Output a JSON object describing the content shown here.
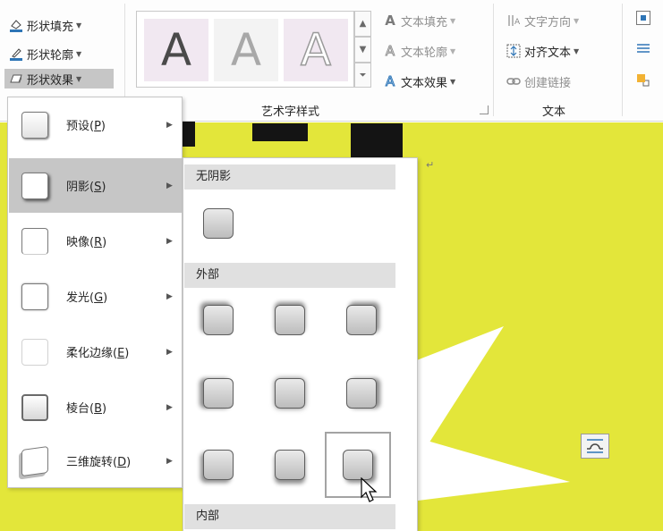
{
  "ribbon": {
    "shape_fill": "形状填充",
    "shape_outline": "形状轮廓",
    "shape_effects": "形状效果",
    "wordart_gallery": [
      "A",
      "A",
      "A"
    ],
    "text_fill": "文本填充",
    "text_outline": "文本轮廓",
    "text_effects": "文本效果",
    "wordart_group_label": "艺术字样式",
    "text_direction": "文字方向",
    "align_text": "对齐文本",
    "create_link": "创建链接",
    "text_group_label": "文本"
  },
  "menu": {
    "items": [
      {
        "label": "预设(",
        "key": "P",
        "close": ")"
      },
      {
        "label": "阴影(",
        "key": "S",
        "close": ")"
      },
      {
        "label": "映像(",
        "key": "R",
        "close": ")"
      },
      {
        "label": "发光(",
        "key": "G",
        "close": ")"
      },
      {
        "label": "柔化边缘(",
        "key": "E",
        "close": ")"
      },
      {
        "label": "棱台(",
        "key": "B",
        "close": ")"
      },
      {
        "label": "三维旋转(",
        "key": "D",
        "close": ")"
      }
    ]
  },
  "submenu": {
    "no_shadow": "无阴影",
    "outer": "外部",
    "inner": "内部"
  },
  "colors": {
    "document_bg": "#e3e63a",
    "menu_highlight": "#c6c6c6",
    "accent_blue": "#2e75b6"
  },
  "icons": [
    "shape-fill-icon",
    "shape-outline-icon",
    "shape-effects-icon",
    "text-fill-icon",
    "text-outline-icon",
    "text-effects-icon",
    "text-direction-icon",
    "align-text-icon",
    "create-link-icon",
    "layout-options-icon",
    "mouse-cursor-icon"
  ]
}
